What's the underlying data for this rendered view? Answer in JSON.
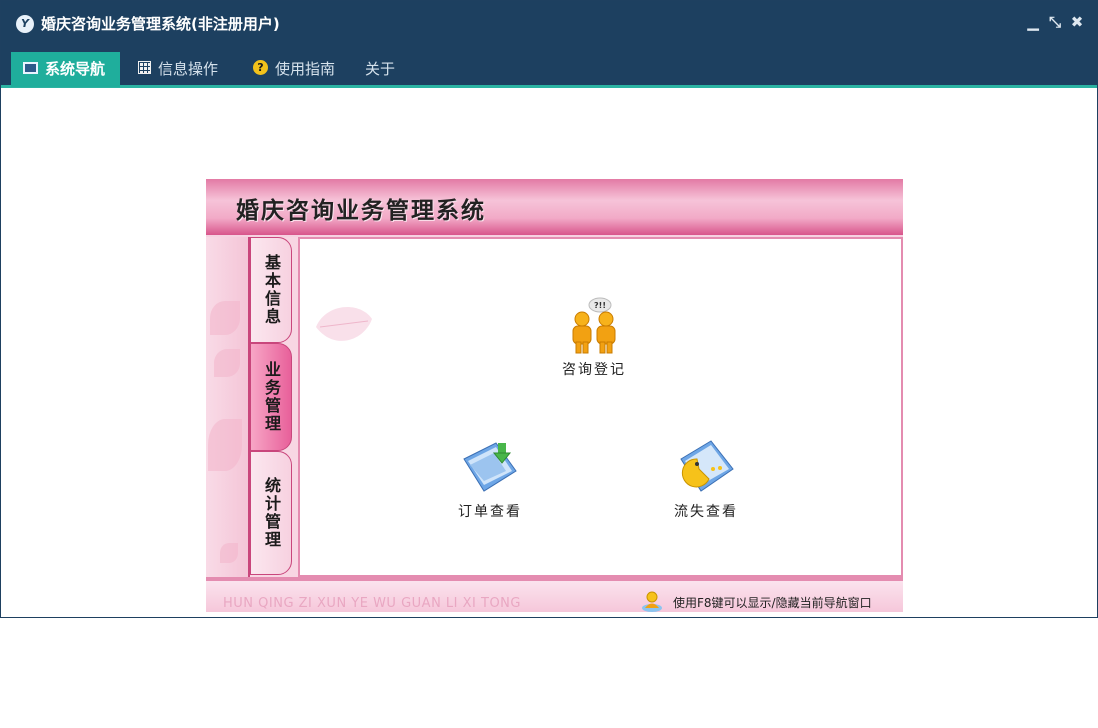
{
  "window": {
    "title": "婚庆咨询业务管理系统(非注册用户)",
    "app_logo_glyph": "Y",
    "controls": {
      "minimize": "▁",
      "restore": "⤡",
      "close": "✖"
    }
  },
  "menu": {
    "items": [
      {
        "label": "系统导航",
        "icon": "monitor-icon",
        "active": true
      },
      {
        "label": "信息操作",
        "icon": "grid-icon",
        "active": false
      },
      {
        "label": "使用指南",
        "icon": "help-icon",
        "active": false
      },
      {
        "label": "关于",
        "icon": "",
        "active": false
      }
    ]
  },
  "panel": {
    "title": "婚庆咨询业务管理系统",
    "side_tabs": [
      {
        "label": "基本信息",
        "active": false
      },
      {
        "label": "业务管理",
        "active": true
      },
      {
        "label": "统计管理",
        "active": false
      }
    ],
    "functions": [
      {
        "label": "咨询登记",
        "icon": "consult-people-icon",
        "badge": "?!!"
      },
      {
        "label": "订单查看",
        "icon": "order-download-icon"
      },
      {
        "label": "流失查看",
        "icon": "pacman-document-icon"
      }
    ],
    "footer": {
      "pinyin": "HUN QING ZI XUN YE WU GUAN LI XI TONG",
      "tip": "使用F8键可以显示/隐藏当前导航窗口"
    }
  },
  "colors": {
    "titlebar": "#1d4060",
    "menu_active": "#1fae9c",
    "accent_line": "#2bb3a2",
    "panel_pink": "#e37aa5",
    "panel_border": "#e48cb0"
  }
}
